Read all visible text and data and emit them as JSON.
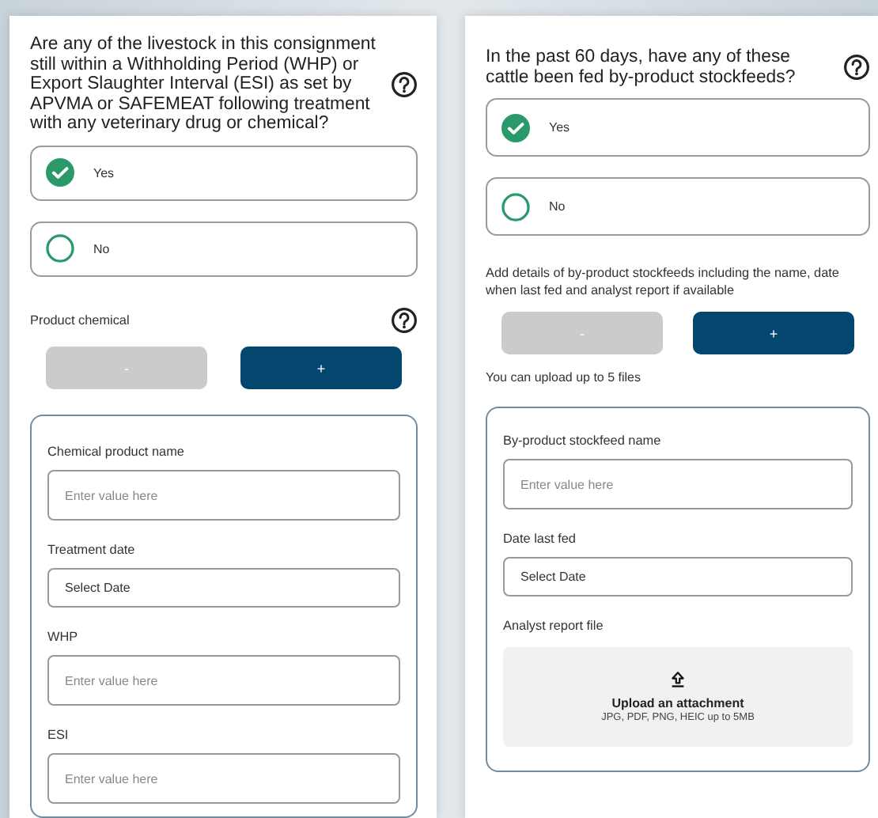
{
  "panels": [
    {
      "question": "Are any of the livestock in this consignment still within a Withholding Period (WHP) or Export Slaughter Interval (ESI) as set by APVMA or SAFEMEAT following treatment with any veterinary drug or chemical?",
      "options": [
        {
          "label": "Yes",
          "selected": true
        },
        {
          "label": "No",
          "selected": false
        }
      ],
      "section_label": "Product chemical",
      "section_help": true,
      "buttons": [
        {
          "label": "-",
          "disabled": true
        },
        {
          "label": "+",
          "disabled": false
        }
      ],
      "card": {
        "fields": [
          {
            "kind": "text",
            "label": "Chemical product name",
            "placeholder": "Enter value here"
          },
          {
            "kind": "date",
            "label": "Treatment date",
            "value": "Select Date"
          },
          {
            "kind": "text",
            "label": "WHP",
            "placeholder": "Enter value here"
          },
          {
            "kind": "text",
            "label": "ESI",
            "placeholder": "Enter value here"
          }
        ]
      }
    },
    {
      "question": "In the past 60 days, have any of these cattle been fed by-product stockfeeds?",
      "options": [
        {
          "label": "Yes",
          "selected": true
        },
        {
          "label": "No",
          "selected": false
        }
      ],
      "section_label": "Add details of by-product stockfeeds including the name, date when last fed and analyst report if available",
      "section_help": false,
      "buttons": [
        {
          "label": "-",
          "disabled": true
        },
        {
          "label": "+",
          "disabled": false
        }
      ],
      "note": "You can upload up to 5 files",
      "card": {
        "fields": [
          {
            "kind": "text",
            "label": "By-product stockfeed name",
            "placeholder": "Enter value here"
          },
          {
            "kind": "date",
            "label": "Date last fed",
            "value": "Select Date"
          },
          {
            "kind": "upload",
            "label": "Analyst report file",
            "title": "Upload an attachment",
            "hint": "JPG, PDF, PNG, HEIC up to 5MB"
          }
        ]
      }
    }
  ]
}
